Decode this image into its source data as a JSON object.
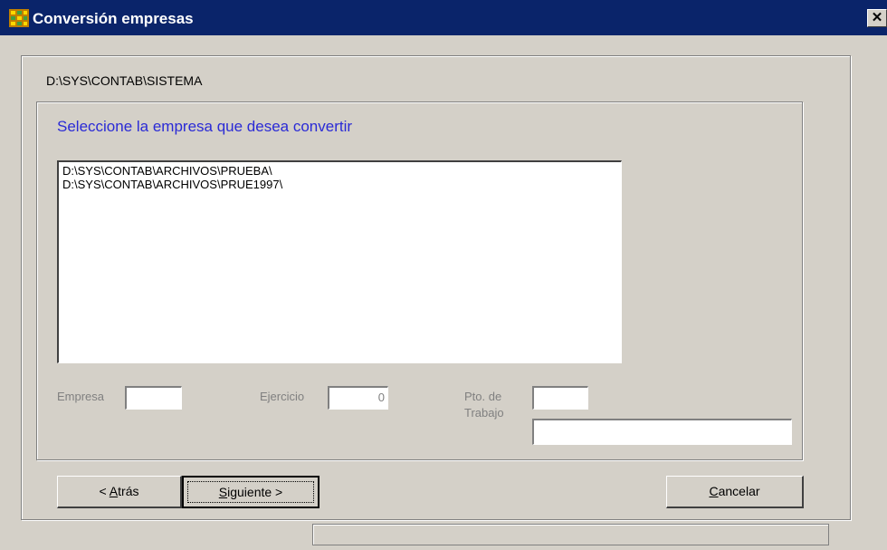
{
  "window": {
    "title": "Conversión empresas",
    "close_glyph": "✕"
  },
  "header": {
    "path": "D:\\SYS\\CONTAB\\SISTEMA"
  },
  "group": {
    "prompt": "Seleccione la empresa que desea convertir",
    "list_items": [
      "D:\\SYS\\CONTAB\\ARCHIVOS\\PRUEBA\\",
      "D:\\SYS\\CONTAB\\ARCHIVOS\\PRUE1997\\"
    ]
  },
  "fields": {
    "empresa_label": "Empresa",
    "empresa_value": "",
    "ejercicio_label": "Ejercicio",
    "ejercicio_value": "0",
    "pto_label_line1": "Pto. de",
    "pto_label_line2": "Trabajo",
    "pto_value": "",
    "pto_description": ""
  },
  "buttons": {
    "back_prefix": "< ",
    "back_mnemonic": "A",
    "back_rest": "trás",
    "next_mnemonic": "S",
    "next_rest": "iguiente >",
    "cancel_mnemonic": "C",
    "cancel_rest": "ancelar"
  },
  "icons": {
    "app": "app-grid-icon",
    "close": "close-icon"
  }
}
